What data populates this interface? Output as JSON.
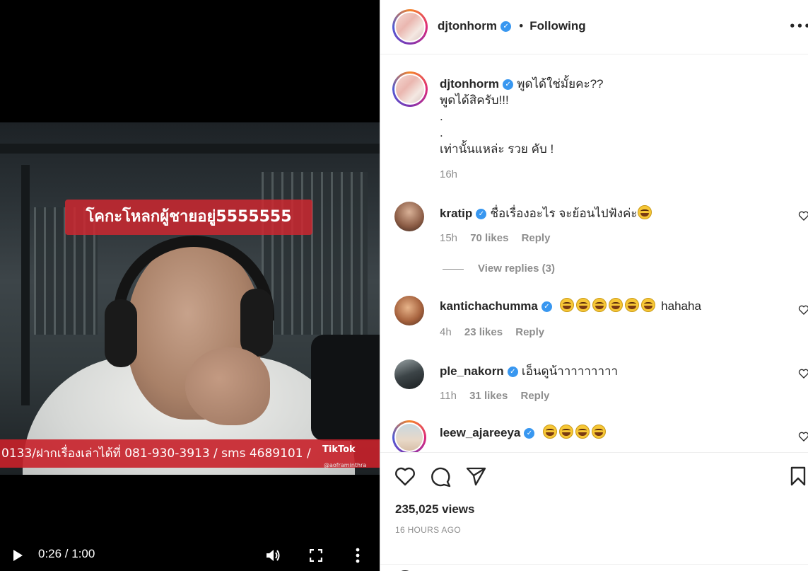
{
  "video": {
    "caption_overlay": "โคกะโหลกผู้ชายอยู่5555555",
    "bottom_strip": "0133/ฝากเรื่องเล่าได้ที่ 081-930-3913 / sms 4689101 /",
    "tiktok_logo": "TikTok",
    "tiktok_handle": "@aoframinthra",
    "time": "0:26 / 1:00"
  },
  "header": {
    "username": "djtonhorm",
    "separator": "•",
    "follow_status": "Following",
    "more": "•••"
  },
  "post": {
    "username": "djtonhorm",
    "caption_line1": "พูดได้ใช่มั้ยคะ??",
    "caption_line2": "พูดได้สิครับ!!!",
    "caption_line3": ".",
    "caption_line4": ".",
    "caption_line5": "เท่านั้นแหล่ะ รวย คับ !",
    "time": "16h"
  },
  "comments": [
    {
      "username": "kratip",
      "text": "ชื่อเรื่องอะไร จะย้อนไปฟังค่ะ",
      "emoji_count": 1,
      "time": "15h",
      "likes": "70 likes",
      "reply": "Reply",
      "view_replies": "View replies (3)"
    },
    {
      "username": "kantichachumma",
      "text": "hahaha",
      "emoji_count": 6,
      "time": "4h",
      "likes": "23 likes",
      "reply": "Reply"
    },
    {
      "username": "ple_nakorn",
      "text": "เอ็นดูน้าาาาาาาาา",
      "emoji_count": 0,
      "time": "11h",
      "likes": "31 likes",
      "reply": "Reply"
    },
    {
      "username": "leew_ajareeya",
      "text": "",
      "emoji_count": 4
    }
  ],
  "stats": {
    "views": "235,025 views",
    "ago": "16 HOURS AGO"
  },
  "icons": {
    "like": "heart-icon",
    "comment": "comment-icon",
    "share": "paper-plane-icon",
    "save": "bookmark-icon",
    "play": "play-icon",
    "volume": "volume-icon",
    "fullscreen": "fullscreen-icon",
    "video_more": "vertical-dots-icon"
  },
  "colors": {
    "verified": "#3897f0",
    "caption_red": "#cd2830",
    "text": "#262626",
    "muted": "#8e8e8e"
  }
}
